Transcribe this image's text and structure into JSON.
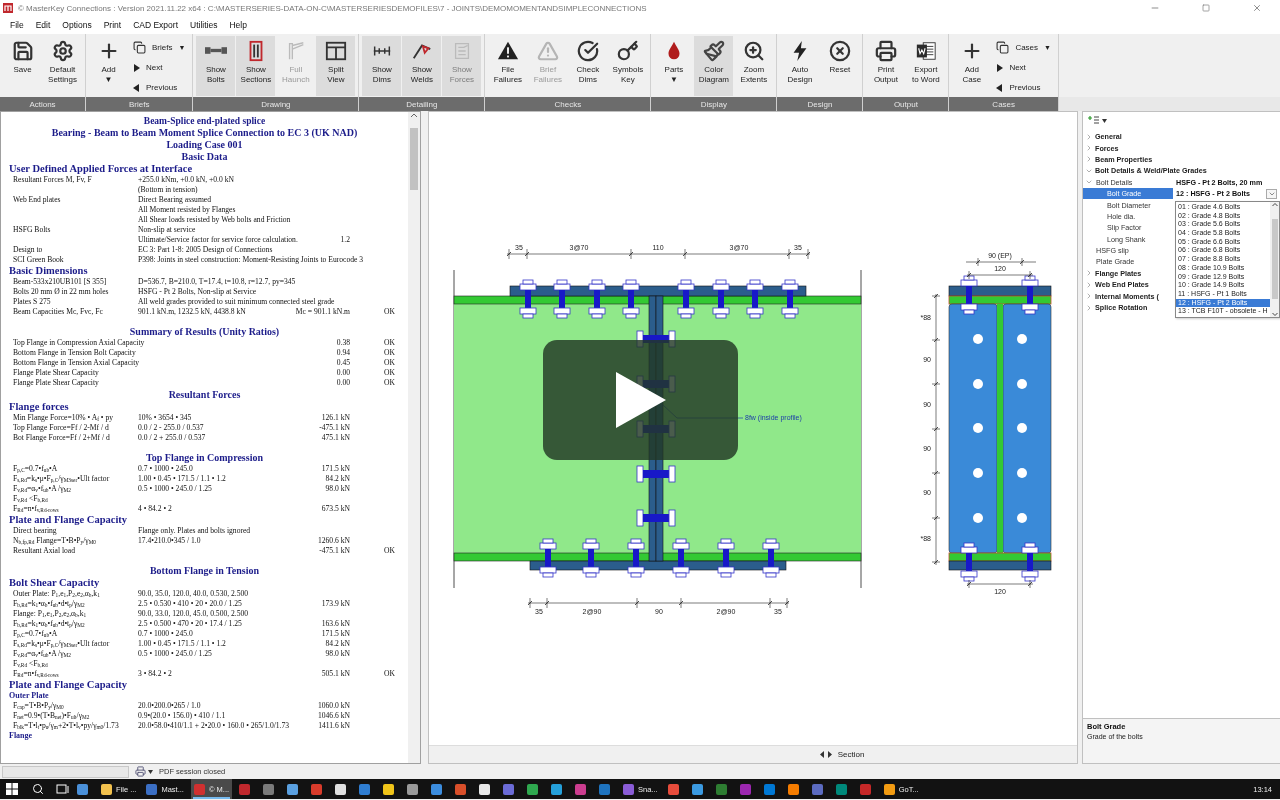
{
  "window": {
    "title": "© MasterKey Connections : Version 2021.11.22 x64 : C:\\MASTERSERIES-DATA-ON-C\\MASTERSERIESDEMOFILES\\7 - JOINTS\\DEMOMOMENTANDSIMPLECONNECTIONS"
  },
  "menu": [
    "File",
    "Edit",
    "Options",
    "Print",
    "CAD Export",
    "Utilities",
    "Help"
  ],
  "ribbon": {
    "groups": [
      {
        "label": "Actions",
        "items": [
          {
            "kind": "large",
            "label": [
              "Save"
            ],
            "pressed": false,
            "disabled": false
          },
          {
            "kind": "large",
            "label": [
              "Default",
              "Settings"
            ],
            "pressed": false,
            "disabled": false
          }
        ]
      },
      {
        "label": "Briefs",
        "items": [
          {
            "kind": "large",
            "label": [
              "Add"
            ],
            "caret": "▼",
            "pressed": false,
            "disabled": false
          },
          {
            "kind": "stack",
            "items": [
              {
                "label": "Briefs",
                "caret": "▼"
              },
              {
                "label": "Next"
              },
              {
                "label": "Previous"
              }
            ]
          }
        ]
      },
      {
        "label": "Drawing",
        "items": [
          {
            "kind": "large",
            "label": [
              "Show",
              "Bolts"
            ],
            "pressed": true,
            "disabled": false
          },
          {
            "kind": "large",
            "label": [
              "Show",
              "Sections"
            ],
            "pressed": true,
            "disabled": false
          },
          {
            "kind": "large",
            "label": [
              "Full",
              "Haunch"
            ],
            "pressed": false,
            "disabled": true
          },
          {
            "kind": "large",
            "label": [
              "Split",
              "View"
            ],
            "pressed": true,
            "disabled": false
          }
        ]
      },
      {
        "label": "Detailing",
        "items": [
          {
            "kind": "large",
            "label": [
              "Show",
              "Dims"
            ],
            "pressed": true,
            "disabled": false
          },
          {
            "kind": "large",
            "label": [
              "Show",
              "Welds"
            ],
            "pressed": true,
            "disabled": false
          },
          {
            "kind": "large",
            "label": [
              "Show",
              "Forces"
            ],
            "pressed": true,
            "disabled": true
          }
        ]
      },
      {
        "label": "Checks",
        "items": [
          {
            "kind": "large",
            "label": [
              "File",
              "Failures"
            ],
            "pressed": false,
            "disabled": false
          },
          {
            "kind": "large",
            "label": [
              "Brief",
              "Failures"
            ],
            "pressed": false,
            "disabled": true
          },
          {
            "kind": "large",
            "label": [
              "Check",
              "Dims"
            ],
            "pressed": false,
            "disabled": false
          },
          {
            "kind": "large",
            "label": [
              "Symbols",
              "Key"
            ],
            "pressed": false,
            "disabled": false
          }
        ]
      },
      {
        "label": "Display",
        "items": [
          {
            "kind": "large",
            "label": [
              "Parts"
            ],
            "caret": "▼",
            "pressed": false,
            "disabled": false
          },
          {
            "kind": "large",
            "label": [
              "Color",
              "Diagram"
            ],
            "pressed": true,
            "disabled": false
          },
          {
            "kind": "large",
            "label": [
              "Zoom",
              "Extents"
            ],
            "pressed": false,
            "disabled": false
          }
        ]
      },
      {
        "label": "Design",
        "items": [
          {
            "kind": "large",
            "label": [
              "Auto",
              "Design"
            ],
            "pressed": false,
            "disabled": false
          },
          {
            "kind": "large",
            "label": [
              "Reset"
            ],
            "pressed": false,
            "disabled": false
          }
        ]
      },
      {
        "label": "Output",
        "items": [
          {
            "kind": "large",
            "label": [
              "Print",
              "Output"
            ],
            "pressed": false,
            "disabled": false
          },
          {
            "kind": "large",
            "label": [
              "Export",
              "to Word"
            ],
            "pressed": false,
            "disabled": false
          }
        ]
      },
      {
        "label": "Cases",
        "items": [
          {
            "kind": "large",
            "label": [
              "Add",
              "Case"
            ],
            "pressed": false,
            "disabled": false
          },
          {
            "kind": "stack",
            "items": [
              {
                "label": "Cases",
                "caret": "▼"
              },
              {
                "label": "Next"
              },
              {
                "label": "Previous"
              }
            ]
          }
        ]
      }
    ]
  },
  "report": [
    {
      "kind": "title",
      "text": "Beam-Splice end-plated splice"
    },
    {
      "kind": "title",
      "text": "Bearing - Beam to Beam Moment Splice Connection to EC 3 (UK NAD)"
    },
    {
      "kind": "title",
      "text": "Loading Case 001"
    },
    {
      "kind": "title",
      "text": "Basic Data"
    },
    {
      "kind": "subheading",
      "text": "User Defined Applied Forces at Interface"
    },
    {
      "kind": "row",
      "label": "Resultant Forces M, Fv, F",
      "value": "+255.0 kNm, +0.0 kN, +0.0 kN"
    },
    {
      "kind": "row",
      "value": "(Bottom in tension)"
    },
    {
      "kind": "row",
      "label": "Web End plates",
      "value": "Direct Bearing assumed"
    },
    {
      "kind": "row",
      "value": "All Moment resisted by Flanges"
    },
    {
      "kind": "row",
      "value": "All Shear loads resisted by Web bolts and Friction"
    },
    {
      "kind": "row",
      "label": "HSFG Bolts",
      "value": "Non-slip at service"
    },
    {
      "kind": "row",
      "value": "Ultimate/Service factor for service force calculation.",
      "result": "1.2"
    },
    {
      "kind": "row",
      "label": "Design to",
      "value": "EC 3: Part 1-8: 2005 Design of Connections"
    },
    {
      "kind": "row",
      "label": "SCI Green Book",
      "value": "P398: Joints in steel construction: Moment-Resisting Joints to Eurocode 3"
    },
    {
      "kind": "subheading",
      "text": "Basic Dimensions"
    },
    {
      "kind": "row",
      "label": "Beam-533x210UB101 [S 355]",
      "value": "D=536.7, B=210.0, T=17.4, t=10.8, r=12.7, py=345"
    },
    {
      "kind": "row",
      "label": "Bolts 20 mm Ø in 22 mm holes",
      "value": "HSFG - Pt 2 Bolts, Non-slip at Service"
    },
    {
      "kind": "row",
      "label": "Plates S 275",
      "value": "All weld grades provided to suit minimum connected steel grade"
    },
    {
      "kind": "row",
      "label": "Beam Capacities Mc, Fvc, Fc",
      "value": "901.1 kN.m,  1232.5 kN,  4438.8 kN",
      "result": "Mc = 901.1 kN.m",
      "status": "OK"
    },
    {
      "kind": "gap"
    },
    {
      "kind": "heading",
      "text": "Summary of Results (Unity Ratios)"
    },
    {
      "kind": "row",
      "label": "Top Flange in Compression Axial Capacity",
      "result": "0.38",
      "status": "OK"
    },
    {
      "kind": "row",
      "label": "Bottom Flange in Tension Bolt Capacity",
      "result": "0.94",
      "status": "OK"
    },
    {
      "kind": "row",
      "label": "Bottom Flange in Tension Axial Capacity",
      "result": "0.45",
      "status": "OK"
    },
    {
      "kind": "row",
      "label": "Flange Plate Shear Capacity",
      "result": "0.00",
      "status": "OK"
    },
    {
      "kind": "row",
      "label": "Flange Plate Shear Capacity",
      "result": "0.00",
      "status": "OK"
    },
    {
      "kind": "heading",
      "text": "Resultant Forces"
    },
    {
      "kind": "subheading",
      "text": "Flange forces"
    },
    {
      "kind": "row",
      "label": "Min Flange Force=10% • A$_{f}$ • py",
      "value": "10% • 3654 • 345",
      "result": "126.1 kN"
    },
    {
      "kind": "row",
      "label": "Top Flange Force=Ff / 2-Mf / d",
      "value": "0.0 / 2  - 255.0 / 0.537",
      "result": "-475.1 kN"
    },
    {
      "kind": "row",
      "label": "Bot Flange Force=Ff / 2+Mf / d",
      "value": "0.0 / 2 + 255.0 / 0.537",
      "result": "475.1 kN"
    },
    {
      "kind": "gap"
    },
    {
      "kind": "heading",
      "text": "Top Flange in Compression"
    },
    {
      "kind": "row",
      "label": "F$_{p,C}$=0.7•f$_{ub}$•A",
      "value": "0.7 • 1000 • 245.0",
      "result": "171.5 kN"
    },
    {
      "kind": "row",
      "label": "F$_{s,Rd}$=k$_{s}$•μ•F$_{p,C}$/γ$_{M3ser}$•Ult factor",
      "value": "1.00 • 0.45 • 171.5 / 1.1 • 1.2",
      "result": "84.2 kN"
    },
    {
      "kind": "row",
      "label": "F$_{v,Rd}$=α$_{v}$•f$_{ub}$•A /γ$_{M2}$",
      "value": "0.5 • 1000 • 245.0 / 1.25",
      "result": "98.0 kN"
    },
    {
      "kind": "row",
      "label": "F$_{v,Rd}$ <F$_{b,Rd}$"
    },
    {
      "kind": "row",
      "label": "F$_{Rd}$=n•f$_{v,Rd-rows}$",
      "value": "4 • 84.2 • 2",
      "result": "673.5 kN"
    },
    {
      "kind": "subheading",
      "text": "Plate and Flange Capacity"
    },
    {
      "kind": "row",
      "label": "Direct bearing",
      "value": "Flange only. Plates and bolts ignored"
    },
    {
      "kind": "row",
      "label": "N$_{b,fp,Rd}$ Flange=T•B•P$_{y}$/γ$_{M0}$",
      "value": "17.4•210.0•345 / 1.0",
      "result": "1260.6 kN"
    },
    {
      "kind": "row",
      "label": "Resultant Axial load",
      "result": "-475.1 kN",
      "status": "OK"
    },
    {
      "kind": "gap"
    },
    {
      "kind": "heading",
      "text": "Bottom Flange in Tension"
    },
    {
      "kind": "subheading",
      "text": "Bolt Shear Capacity"
    },
    {
      "kind": "row",
      "label": "Outer Plate: P$_{1}$,e$_{1}$,P$_{2}$,e$_{2}$,α$_{b}$,k$_{1}$",
      "value": "90.0, 35.0, 120.0, 40.0, 0.530, 2.500"
    },
    {
      "kind": "row",
      "label": "F$_{b,Rd}$=k$_{1}$•α$_{b}$•f$_{ub}$•d•t$_{p}$/γ$_{M2}$",
      "value": "2.5 • 0.530 • 410 • 20 • 20.0 / 1.25",
      "result": "173.9 kN"
    },
    {
      "kind": "row",
      "label": "Flange: P$_{1}$,e$_{1}$,P$_{2}$,e$_{2}$,α$_{b}$,k$_{1}$",
      "value": "90.0, 33.0, 120.0, 45.0, 0.500, 2.500"
    },
    {
      "kind": "row",
      "label": "F$_{b,Rd}$=k$_{1}$•α$_{b}$•f$_{ub}$•d•t$_{p}$/γ$_{M2}$",
      "value": "2.5 • 0.500 • 470 • 20 • 17.4 / 1.25",
      "result": "163.6 kN"
    },
    {
      "kind": "row",
      "label": "F$_{p,C}$=0.7•f$_{ub}$•A",
      "value": "0.7 • 1000 • 245.0",
      "result": "171.5 kN"
    },
    {
      "kind": "row",
      "label": "F$_{s,Rd}$=k$_{s}$•μ•F$_{p,C}$/γ$_{M3ser}$•Ult factor",
      "value": "1.00 • 0.45 • 171.5 / 1.1 • 1.2",
      "result": "84.2 kN"
    },
    {
      "kind": "row",
      "label": "F$_{v,Rd}$=α$_{v}$•f$_{ub}$•A /γ$_{M2}$",
      "value": "0.5 • 1000 • 245.0 / 1.25",
      "result": "98.0 kN"
    },
    {
      "kind": "row",
      "label": "F$_{v,Rd}$ <F$_{b,Rd}$"
    },
    {
      "kind": "row",
      "label": "F$_{Rd}$=n•f$_{v,Rd-rows}$",
      "value": "3 • 84.2 • 2",
      "result": "505.1 kN",
      "status": "OK"
    },
    {
      "kind": "subheading",
      "text": "Plate and Flange Capacity"
    },
    {
      "kind": "minor",
      "text": "Outer Plate"
    },
    {
      "kind": "row",
      "label": "F$_{cap}$=T•B•P$_{y}$/γ$_{M0}$",
      "value": "20.0•200.0•265 / 1.0",
      "result": "1060.0 kN"
    },
    {
      "kind": "row",
      "label": "F$_{net}$=0.9•(T•B$_{net}$)•F$_{ult}$/γ$_{M2}$",
      "value": "0.9•(20.0 • 156.0) • 410 / 1.1",
      "result": "1046.6 kN"
    },
    {
      "kind": "row",
      "label": "F$_{blk}$=T•l$_{t}$•p$_{u}$/γ$_{m}$+2•T•l$_{v}$•py/γ$_{m0}$/1.73",
      "value": "20.0•58.0•410/1.1 + 2•20.0 • 160.0 • 265/1.0/1.73",
      "result": "1411.6 kN"
    },
    {
      "kind": "minor",
      "text": "Flange"
    }
  ],
  "drawing": {
    "top_dims": [
      "35",
      "3@70",
      "110",
      "3@70",
      "35"
    ],
    "bottom_dims": [
      "35",
      "2@90",
      "90",
      "2@90",
      "35"
    ],
    "section_top_dims": [
      "90 (EP)",
      "120"
    ],
    "section_bottom_dims": [
      "120"
    ],
    "section_side_dims": [
      "*88",
      "90",
      "90",
      "90",
      "90",
      "*88"
    ],
    "weld_label": "8fw (inside profile)",
    "view_tab": "Section"
  },
  "properties": {
    "rows": [
      {
        "kind": "category",
        "label": "General",
        "expanded": false
      },
      {
        "kind": "category",
        "label": "Forces",
        "expanded": false
      },
      {
        "kind": "category",
        "label": "Beam Properties",
        "expanded": false
      },
      {
        "kind": "category",
        "label": "Bolt Details & Weld/Plate Grades",
        "expanded": true,
        "children": [
          {
            "kind": "group",
            "label": "Bolt Details",
            "value": "HSFG - Pt 2 Bolts, 20 mm",
            "expanded": true,
            "children": [
              {
                "kind": "property",
                "label": "Bolt Grade",
                "value": "12 : HSFG - Pt 2 Bolts",
                "selected": true
              },
              {
                "kind": "property",
                "label": "Bolt Diameter",
                "selected": false
              },
              {
                "kind": "property",
                "label": "Hole dia.",
                "selected": false
              },
              {
                "kind": "property",
                "label": "Slip Factor",
                "selected": false
              },
              {
                "kind": "property",
                "label": "Long Shank",
                "selected": false
              }
            ]
          },
          {
            "kind": "property",
            "label": "HSFG slip",
            "selected": false
          },
          {
            "kind": "property",
            "label": "Plate Grade",
            "selected": false
          }
        ]
      },
      {
        "kind": "category",
        "label": "Flange Plates",
        "expanded": false
      },
      {
        "kind": "category",
        "label": "Web End Plates",
        "expanded": false
      },
      {
        "kind": "category",
        "label": "Internal Moments (",
        "expanded": false
      },
      {
        "kind": "category",
        "label": "Splice Rotation",
        "expanded": false
      }
    ],
    "dropdown": [
      {
        "label": "01 : Grade 4.6 Bolts",
        "selected": false
      },
      {
        "label": "02 : Grade 4.8 Bolts",
        "selected": false
      },
      {
        "label": "03 : Grade 5.6 Bolts",
        "selected": false
      },
      {
        "label": "04 : Grade 5.8 Bolts",
        "selected": false
      },
      {
        "label": "05 : Grade 6.6 Bolts",
        "selected": false
      },
      {
        "label": "06 : Grade 6.8 Bolts",
        "selected": false
      },
      {
        "label": "07 : Grade 8.8 Bolts",
        "selected": false
      },
      {
        "label": "08 : Grade 10.9 Bolts",
        "selected": false
      },
      {
        "label": "09 : Grade 12.9 Bolts",
        "selected": false
      },
      {
        "label": "10 : Grade 14.9 Bolts",
        "selected": false
      },
      {
        "label": "11 : HSFG - Pt 1 Bolts",
        "selected": false
      },
      {
        "label": "12 : HSFG - Pt 2 Bolts",
        "selected": true
      },
      {
        "label": "13 : TCB F10T - obsolete - H",
        "selected": false
      }
    ],
    "description": {
      "title": "Bolt Grade",
      "text": "Grade of the bolts"
    }
  },
  "status_bar": {
    "message": "PDF session closed"
  },
  "taskbar": {
    "items": [
      {
        "kind": "icon",
        "color": "#4a90d9"
      },
      {
        "kind": "app",
        "label": "File ...",
        "color": "#f2c14e",
        "active": false
      },
      {
        "kind": "app",
        "label": "Mast...",
        "color": "#3b6fc4",
        "active": false
      },
      {
        "kind": "app",
        "label": "© M...",
        "color": "#d03030",
        "active": true
      },
      {
        "kind": "icon",
        "color": "#c0282d"
      },
      {
        "kind": "icon",
        "color": "#7a7a7a"
      },
      {
        "kind": "icon",
        "color": "#5aa0e0"
      },
      {
        "kind": "icon",
        "color": "#d83b2b"
      },
      {
        "kind": "icon",
        "color": "#e0e0e0"
      },
      {
        "kind": "icon",
        "color": "#2f7dd1"
      },
      {
        "kind": "icon",
        "color": "#f0c419"
      },
      {
        "kind": "icon",
        "color": "#9a9a9a"
      },
      {
        "kind": "icon",
        "color": "#3c8dde"
      },
      {
        "kind": "icon",
        "color": "#d94f2a"
      },
      {
        "kind": "icon",
        "color": "#e7e7e7"
      },
      {
        "kind": "icon",
        "color": "#6b6bd6"
      },
      {
        "kind": "icon",
        "color": "#2fa84f"
      },
      {
        "kind": "icon",
        "color": "#25a0da"
      },
      {
        "kind": "icon",
        "color": "#cc3d8f"
      },
      {
        "kind": "icon",
        "color": "#1e73be"
      },
      {
        "kind": "app",
        "label": "Sna...",
        "color": "#8a5cd6",
        "active": false
      },
      {
        "kind": "icon",
        "color": "#e74c3c"
      },
      {
        "kind": "icon",
        "color": "#3b9ae1"
      },
      {
        "kind": "icon",
        "color": "#2e7d32"
      },
      {
        "kind": "icon",
        "color": "#9c27b0"
      },
      {
        "kind": "icon",
        "color": "#0078d4"
      },
      {
        "kind": "icon",
        "color": "#f57c00"
      },
      {
        "kind": "icon",
        "color": "#5c6bc0"
      },
      {
        "kind": "icon",
        "color": "#00897b"
      },
      {
        "kind": "icon",
        "color": "#c62828"
      },
      {
        "kind": "app",
        "label": "GoT...",
        "color": "#f39c12",
        "active": false
      }
    ],
    "clock": "13:14"
  }
}
